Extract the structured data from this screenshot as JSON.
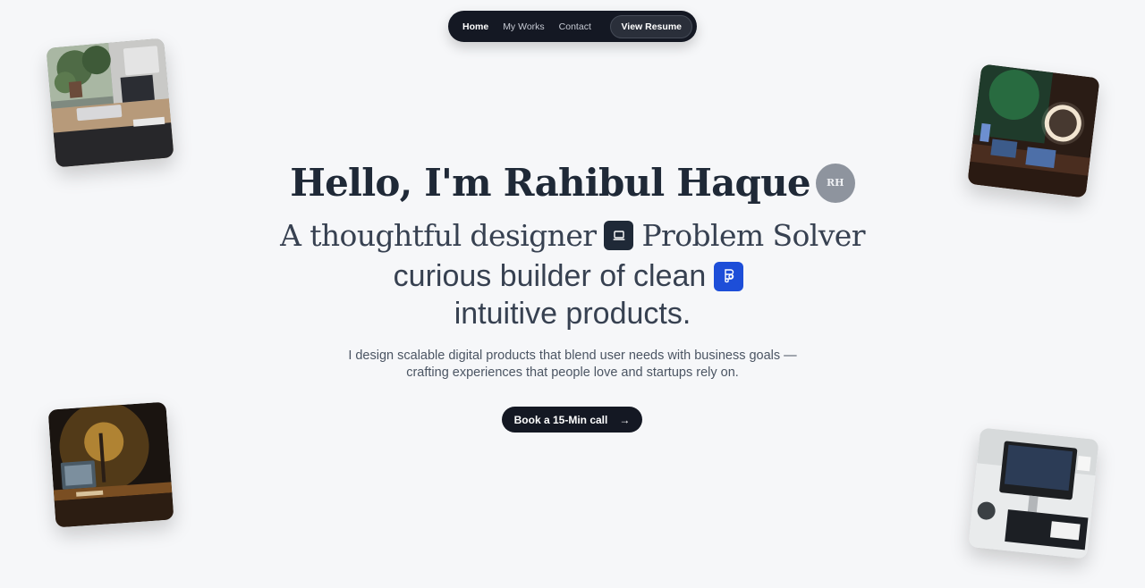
{
  "nav": {
    "items": [
      {
        "label": "Home",
        "active": true
      },
      {
        "label": "My Works",
        "active": false
      },
      {
        "label": "Contact",
        "active": false
      }
    ],
    "resume_label": "View Resume"
  },
  "hero": {
    "greeting": "Hello, I'm Rahibul Haque",
    "avatar_initials": "RH",
    "line1_a": "A thoughtful designer",
    "line1_icon": "laptop-icon",
    "line1_b": "Problem Solver",
    "line2": "curious builder of clean",
    "line2_icon": "figma-icon",
    "line3": "intuitive products.",
    "description": "I design scalable digital products that blend user needs with business goals — crafting experiences that people love and startups rely on.",
    "cta_label": "Book a 15-Min call"
  },
  "colors": {
    "background": "#f6f7f9",
    "dark": "#141823",
    "accent_blue": "#1d4ed8",
    "avatar": "#8e949e"
  }
}
